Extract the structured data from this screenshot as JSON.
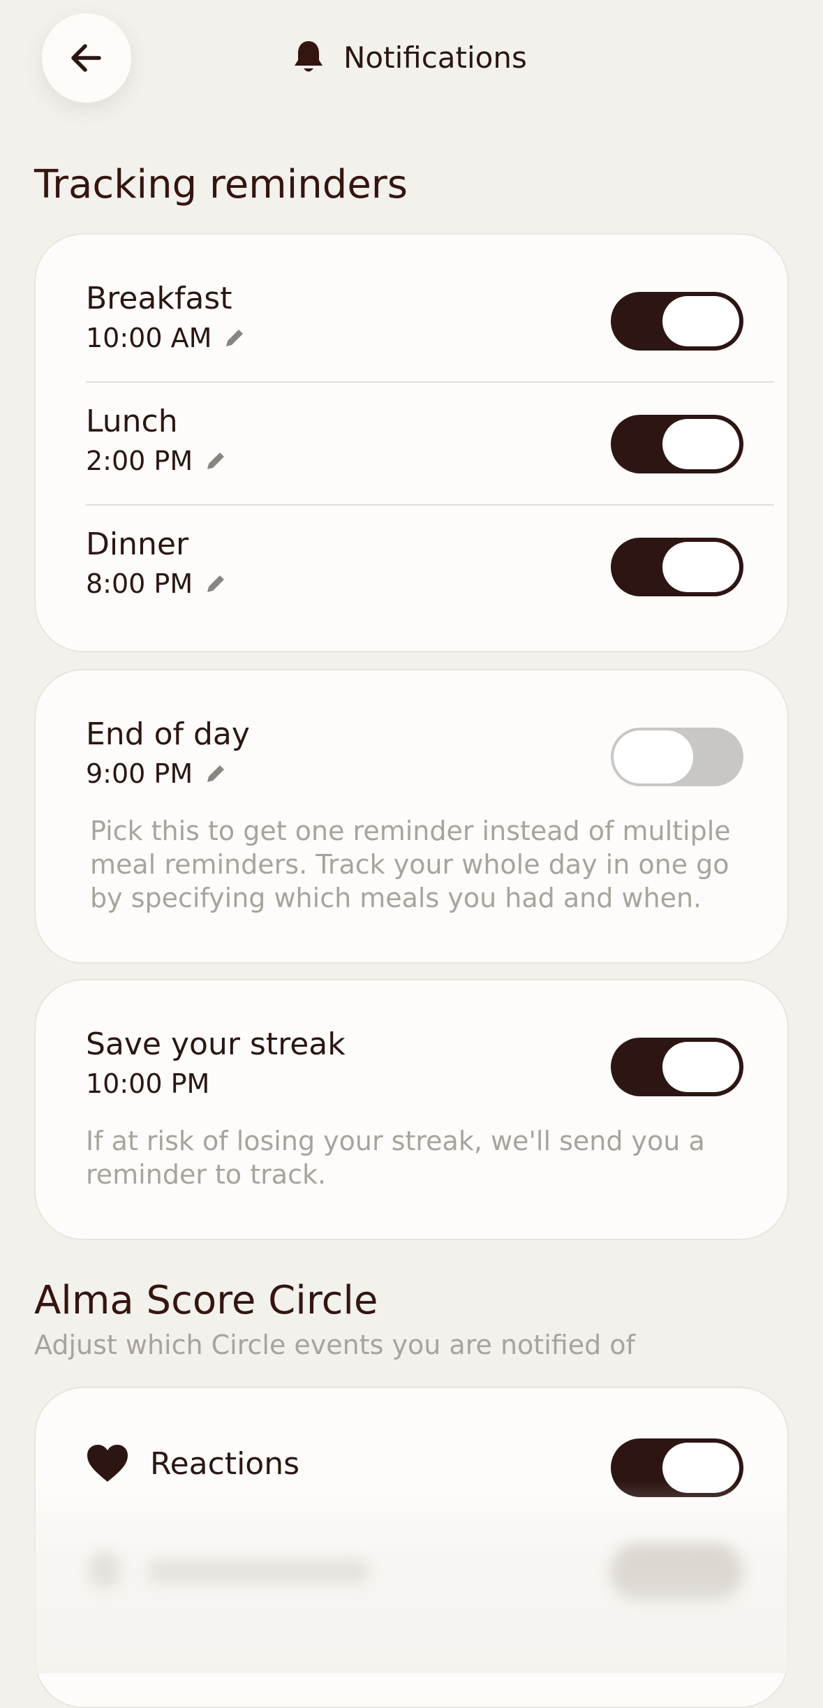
{
  "header": {
    "title": "Notifications"
  },
  "tracking": {
    "heading": "Tracking reminders",
    "meals": [
      {
        "title": "Breakfast",
        "time": "10:00 AM",
        "enabled": true
      },
      {
        "title": "Lunch",
        "time": "2:00 PM",
        "enabled": true
      },
      {
        "title": "Dinner",
        "time": "8:00 PM",
        "enabled": true
      }
    ],
    "end_of_day": {
      "title": "End of day",
      "time": "9:00 PM",
      "enabled": false,
      "description": "Pick this to get one reminder instead of multiple meal reminders. Track your whole day in one go by specifying which meals you had and when."
    },
    "streak": {
      "title": "Save your streak",
      "time": "10:00 PM",
      "enabled": true,
      "description": "If at risk of losing your streak, we'll send you a reminder to track."
    }
  },
  "circle": {
    "heading": "Alma Score Circle",
    "subheading": "Adjust which Circle events you are notified of",
    "items": [
      {
        "label": "Reactions",
        "icon": "heart-icon",
        "enabled": true
      }
    ]
  },
  "colors": {
    "accent": "#2d1513",
    "background": "#f3f1ec",
    "card": "#fdfcfa",
    "muted": "#a8a39c"
  }
}
